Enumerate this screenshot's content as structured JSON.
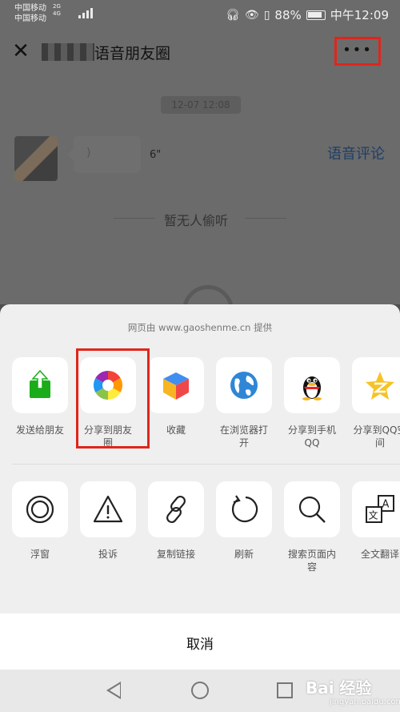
{
  "status_bar": {
    "carrier_1": "中国移动",
    "carrier_2": "中国移动",
    "net_1": "2G",
    "net_2": "4G",
    "battery": "88%",
    "time": "中午12:09"
  },
  "header": {
    "title": "语音朋友圈"
  },
  "content": {
    "timestamp": "12-07 12:08",
    "voice_duration": "6\"",
    "voice_comment": "语音评论",
    "no_listen": "暂无人偷听"
  },
  "sheet": {
    "provider": "网页由 www.gaoshenme.cn 提供",
    "row1": [
      {
        "label": "发送给朋友",
        "icon": "send-to-friend-icon"
      },
      {
        "label": "分享到朋友圈",
        "icon": "moments-icon"
      },
      {
        "label": "收藏",
        "icon": "favorite-cube-icon"
      },
      {
        "label": "在浏览器打开",
        "icon": "browser-globe-icon"
      },
      {
        "label": "分享到手机QQ",
        "icon": "qq-penguin-icon"
      },
      {
        "label": "分享到QQ空间",
        "icon": "qzone-star-icon"
      }
    ],
    "row2": [
      {
        "label": "浮窗",
        "icon": "float-window-icon"
      },
      {
        "label": "投诉",
        "icon": "warning-icon"
      },
      {
        "label": "复制链接",
        "icon": "link-icon"
      },
      {
        "label": "刷新",
        "icon": "refresh-icon"
      },
      {
        "label": "搜索页面内容",
        "icon": "search-icon"
      },
      {
        "label": "全文翻译",
        "icon": "translate-icon"
      }
    ],
    "cancel": "取消"
  },
  "watermark": {
    "main": "Bai 经验",
    "sub": "jingyan.baidu.com"
  },
  "colors": {
    "highlight": "#e0251b",
    "wechat_green": "#1aad19",
    "link_blue": "#1e3f66"
  }
}
